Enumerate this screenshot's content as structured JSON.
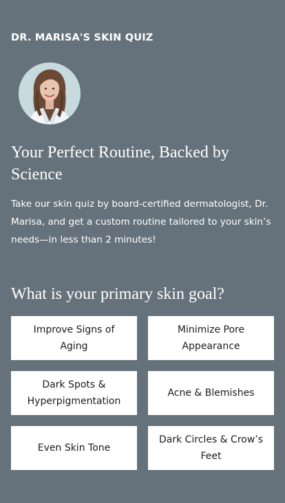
{
  "header": {
    "eyebrow": "DR. MARISA'S SKIN QUIZ"
  },
  "avatar": {
    "icon": "doctor-portrait",
    "colors": {
      "background": "#c7dadd",
      "hair": "#6b4a35",
      "coat": "#f3f5f7",
      "scrubs": "#1f3a6d",
      "skin": "#e8c3ad"
    }
  },
  "hero": {
    "headline": "Your Perfect Routine, Backed by Science",
    "intro": "Take our skin quiz by board-certified dermatologist, Dr. Marisa, and get a custom routine tailored to your skin’s needs—in less than 2 minutes!"
  },
  "quiz": {
    "question": "What is your primary skin goal?",
    "options": [
      {
        "label": "Improve Signs of Aging"
      },
      {
        "label": "Minimize Pore Appearance"
      },
      {
        "label": "Dark Spots & Hyperpigmentation"
      },
      {
        "label": "Acne & Blemishes"
      },
      {
        "label": "Even Skin Tone"
      },
      {
        "label": "Dark Circles & Crow’s Feet"
      }
    ]
  },
  "colors": {
    "page_background": "#66727b",
    "text": "#ffffff",
    "option_background": "#ffffff",
    "option_text": "#1b1b1b"
  }
}
